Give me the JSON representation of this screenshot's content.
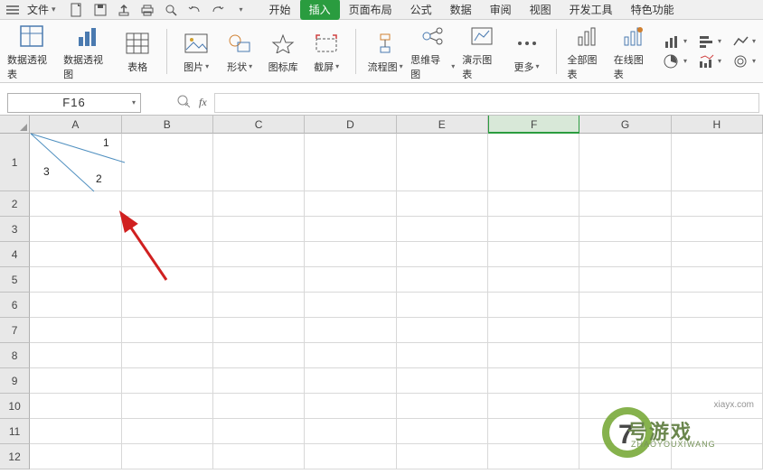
{
  "topbar": {
    "file_label": "文件",
    "tabs": [
      "开始",
      "插入",
      "页面布局",
      "公式",
      "数据",
      "审阅",
      "视图",
      "开发工具",
      "特色功能"
    ],
    "active_tab_index": 1
  },
  "ribbon": {
    "pivot_table": "数据透视表",
    "pivot_chart": "数据透视图",
    "table": "表格",
    "picture": "图片",
    "shapes": "形状",
    "icon_lib": "图标库",
    "screenshot": "截屏",
    "flowchart": "流程图",
    "mindmap": "思维导图",
    "demo_chart": "演示图表",
    "more": "更多",
    "all_charts": "全部图表",
    "online_chart": "在线图表"
  },
  "formula_bar": {
    "name_box": "F16",
    "formula": ""
  },
  "sheet": {
    "columns": [
      "A",
      "B",
      "C",
      "D",
      "E",
      "F",
      "G",
      "H"
    ],
    "selected_col_index": 5,
    "row_count": 12,
    "first_row_tall": true,
    "a1_labels": {
      "n1": "1",
      "n2": "2",
      "n3": "3"
    }
  },
  "watermark": {
    "big": "7",
    "text": "号游戏",
    "sub": "ZHAOYOUXIWANG",
    "url": "xiayx.com"
  }
}
